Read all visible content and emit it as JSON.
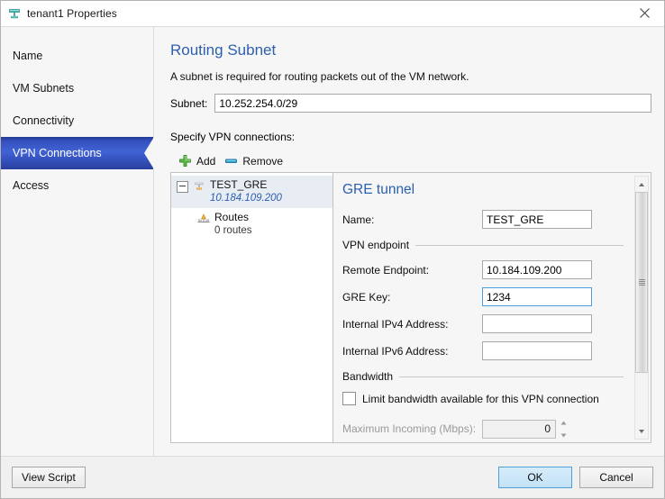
{
  "window": {
    "title": "tenant1 Properties",
    "icon": "network-tenant-icon",
    "close_label": "✕"
  },
  "sidebar": {
    "items": [
      {
        "label": "Name",
        "selected": false
      },
      {
        "label": "VM Subnets",
        "selected": false
      },
      {
        "label": "Connectivity",
        "selected": false
      },
      {
        "label": "VPN Connections",
        "selected": true
      },
      {
        "label": "Access",
        "selected": false
      }
    ]
  },
  "main": {
    "title": "Routing Subnet",
    "description": "A subnet is required for routing packets out of the VM network.",
    "subnet_label": "Subnet:",
    "subnet_value": "10.252.254.0/29",
    "subnet_placeholder": "",
    "specify_label": "Specify VPN connections:",
    "toolbar": {
      "add_label": "Add",
      "remove_label": "Remove"
    },
    "tree": {
      "root": {
        "name": "TEST_GRE",
        "address": "10.184.109.200",
        "icon": "vpn-connection-icon",
        "expanded": true,
        "selected": true
      },
      "child": {
        "name": "Routes",
        "count_label": "0 routes",
        "icon": "routes-icon"
      }
    },
    "detail": {
      "title": "GRE tunnel",
      "fields": [
        {
          "label": "Name:",
          "value": "TEST_GRE",
          "focused": false
        },
        {
          "label": "Remote Endpoint:",
          "value": "10.184.109.200",
          "focused": false
        },
        {
          "label": "GRE Key:",
          "value": "1234",
          "focused": true
        },
        {
          "label": "Internal IPv4 Address:",
          "value": "",
          "focused": false
        },
        {
          "label": "Internal IPv6 Address:",
          "value": "",
          "focused": false
        }
      ],
      "endpoint_group": "VPN endpoint",
      "bandwidth_group": "Bandwidth",
      "limit_checkbox_label": "Limit bandwidth available for this VPN connection",
      "limit_checked": false,
      "max_incoming_label": "Maximum Incoming (Mbps):",
      "max_incoming_value": "0",
      "max_incoming_disabled": true
    }
  },
  "footer": {
    "view_script_label": "View Script",
    "ok_label": "OK",
    "cancel_label": "Cancel"
  },
  "colors": {
    "accent_heading": "#2c5fad",
    "selection_blue": "#3551c0",
    "add_green": "#5cb85c",
    "remove_blue": "#2f9fd0",
    "link_blue": "#2a5fb4"
  }
}
